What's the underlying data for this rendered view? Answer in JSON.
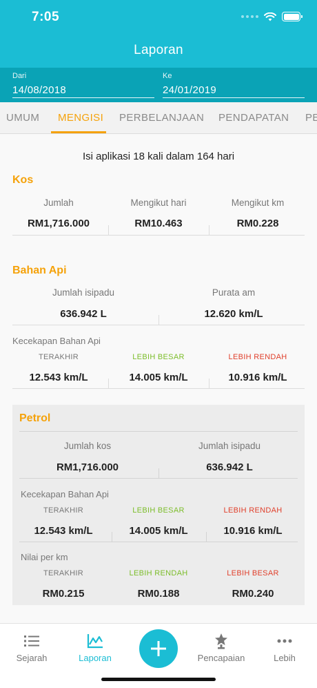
{
  "status": {
    "time": "7:05"
  },
  "header": {
    "title": "Laporan"
  },
  "dates": {
    "from_label": "Dari",
    "from_value": "14/08/2018",
    "to_label": "Ke",
    "to_value": "24/01/2019"
  },
  "tabs": [
    "UMUM",
    "MENGISI",
    "PERBELANJAAN",
    "PENDAPATAN",
    "PE"
  ],
  "summary": "Isi aplikasi 18 kali dalam 164 hari",
  "kos": {
    "title": "Kos",
    "headers": [
      "Jumlah",
      "Mengikut hari",
      "Mengikut km"
    ],
    "values": [
      "RM1,716.000",
      "RM10.463",
      "RM0.228"
    ]
  },
  "bahan_api": {
    "title": "Bahan Api",
    "headers": [
      "Jumlah isipadu",
      "Purata am"
    ],
    "values": [
      "636.942 L",
      "12.620 km/L"
    ],
    "efficiency_label": "Kecekapan Bahan Api",
    "eff_headers": [
      "TERAKHIR",
      "LEBIH BESAR",
      "LEBIH RENDAH"
    ],
    "eff_values": [
      "12.543 km/L",
      "14.005 km/L",
      "10.916 km/L"
    ]
  },
  "petrol": {
    "title": "Petrol",
    "headers": [
      "Jumlah kos",
      "Jumlah isipadu"
    ],
    "values": [
      "RM1,716.000",
      "636.942 L"
    ],
    "efficiency_label": "Kecekapan Bahan Api",
    "eff_headers": [
      "TERAKHIR",
      "LEBIH BESAR",
      "LEBIH RENDAH"
    ],
    "eff_values": [
      "12.543 km/L",
      "14.005 km/L",
      "10.916 km/L"
    ],
    "perkm_label": "Nilai per km",
    "perkm_headers": [
      "TERAKHIR",
      "LEBIH RENDAH",
      "LEBIH BESAR"
    ],
    "perkm_values": [
      "RM0.215",
      "RM0.188",
      "RM0.240"
    ]
  },
  "nav": {
    "items": [
      "Sejarah",
      "Laporan",
      "Pencapaian",
      "Lebih"
    ],
    "active": "Laporan"
  },
  "colors": {
    "primary": "#1bbdd4",
    "primary_dark": "#0aa3b6",
    "accent": "#f5a20a",
    "green": "#7cbd2a",
    "red": "#e0402c"
  }
}
